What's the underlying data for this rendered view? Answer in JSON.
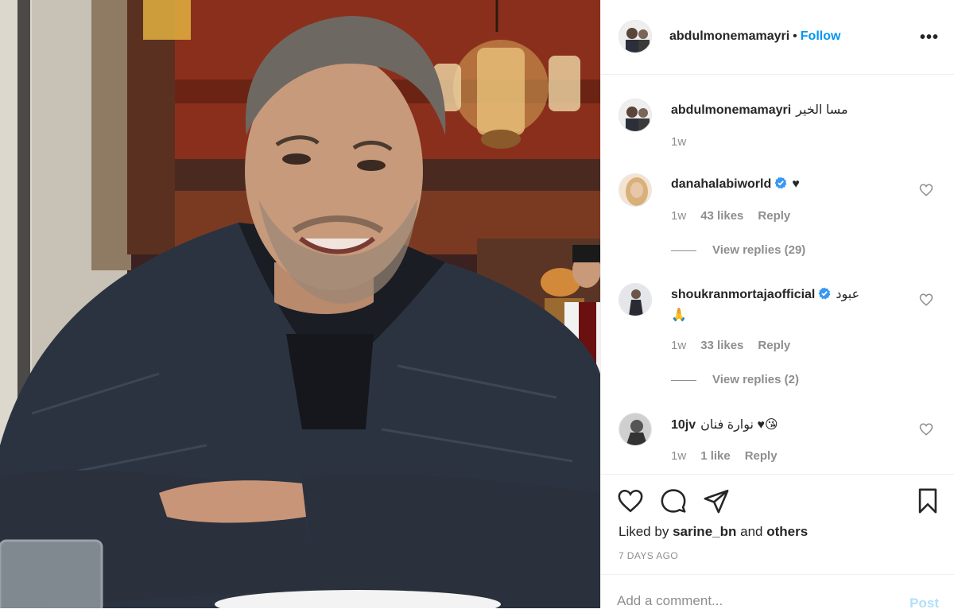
{
  "post": {
    "author": "abdulmonemamayri",
    "separator": "•",
    "follow_label": "Follow",
    "more_label": "•••",
    "caption": {
      "username": "abdulmonemamayri",
      "text": "مسا الخير",
      "time": "1w"
    }
  },
  "comments": [
    {
      "username": "danahalabiworld",
      "verified": true,
      "text": "♥",
      "time": "1w",
      "likes": "43 likes",
      "reply_label": "Reply",
      "view_replies": "View replies (29)"
    },
    {
      "username": "shoukranmortajaofficial",
      "verified": true,
      "text": "عبود",
      "text2": "🙏",
      "time": "1w",
      "likes": "33 likes",
      "reply_label": "Reply",
      "view_replies": "View replies (2)"
    },
    {
      "username": "10jv",
      "verified": false,
      "text": "نوارة فنان ♥😘",
      "time": "1w",
      "likes": "1 like",
      "reply_label": "Reply"
    }
  ],
  "engagement": {
    "liked_by_prefix": "Liked by",
    "liked_by_user": "sarine_bn",
    "liked_by_and": "and",
    "liked_by_others": "others",
    "date": "7 DAYS AGO"
  },
  "add_comment": {
    "placeholder": "Add a comment...",
    "post_label": "Post"
  },
  "icons": {
    "like": "heart-icon",
    "comment": "comment-icon",
    "share": "share-icon",
    "save": "bookmark-icon",
    "more": "more-options-icon",
    "verified": "verified-badge-icon"
  },
  "colors": {
    "link_blue": "#0095f6",
    "verified_blue": "#3897f0",
    "post_disabled": "#b2dffc",
    "muted": "#8e8e8e"
  }
}
